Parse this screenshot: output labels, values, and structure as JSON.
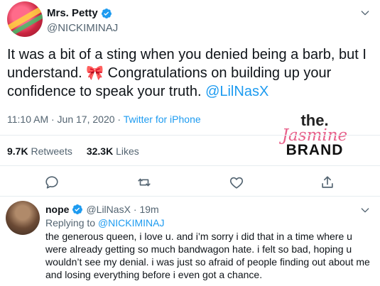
{
  "tweet": {
    "author_name": "Mrs. Petty",
    "author_handle": "@NICKIMINAJ",
    "text_part1": "It was a bit of a sting when you denied being a barb, but I understand. ",
    "emoji": "🎀",
    "text_part2": " Congratulations on building up your confidence to speak your truth. ",
    "mention": "@LilNasX",
    "time": "11:10 AM · Jun 17, 2020 · ",
    "source": "Twitter for iPhone"
  },
  "stats": {
    "retweets_count": "9.7K",
    "retweets_label": "Retweets",
    "likes_count": "32.3K",
    "likes_label": "Likes"
  },
  "watermark": {
    "line1": "the.",
    "line2": "Jasmine",
    "line3": "BRAND"
  },
  "reply": {
    "name": "nope",
    "handle": "@LilNasX",
    "time": "· 19m",
    "replying_prefix": "Replying to ",
    "replying_handle": "@NICKIMINAJ",
    "text": "the generous queen, i love u. and i’m sorry i did that in a time where u were already getting so much bandwagon hate. i felt so bad, hoping u wouldn’t see my denial. i was just so afraid of people finding out about me and losing everything before i even got a chance."
  },
  "colors": {
    "accent": "#1d9bf0",
    "muted": "#536471",
    "divider": "#e6ecf0"
  },
  "icons": [
    "verified-badge-icon",
    "chevron-down-icon",
    "reply-icon",
    "retweet-icon",
    "like-icon",
    "share-icon"
  ]
}
